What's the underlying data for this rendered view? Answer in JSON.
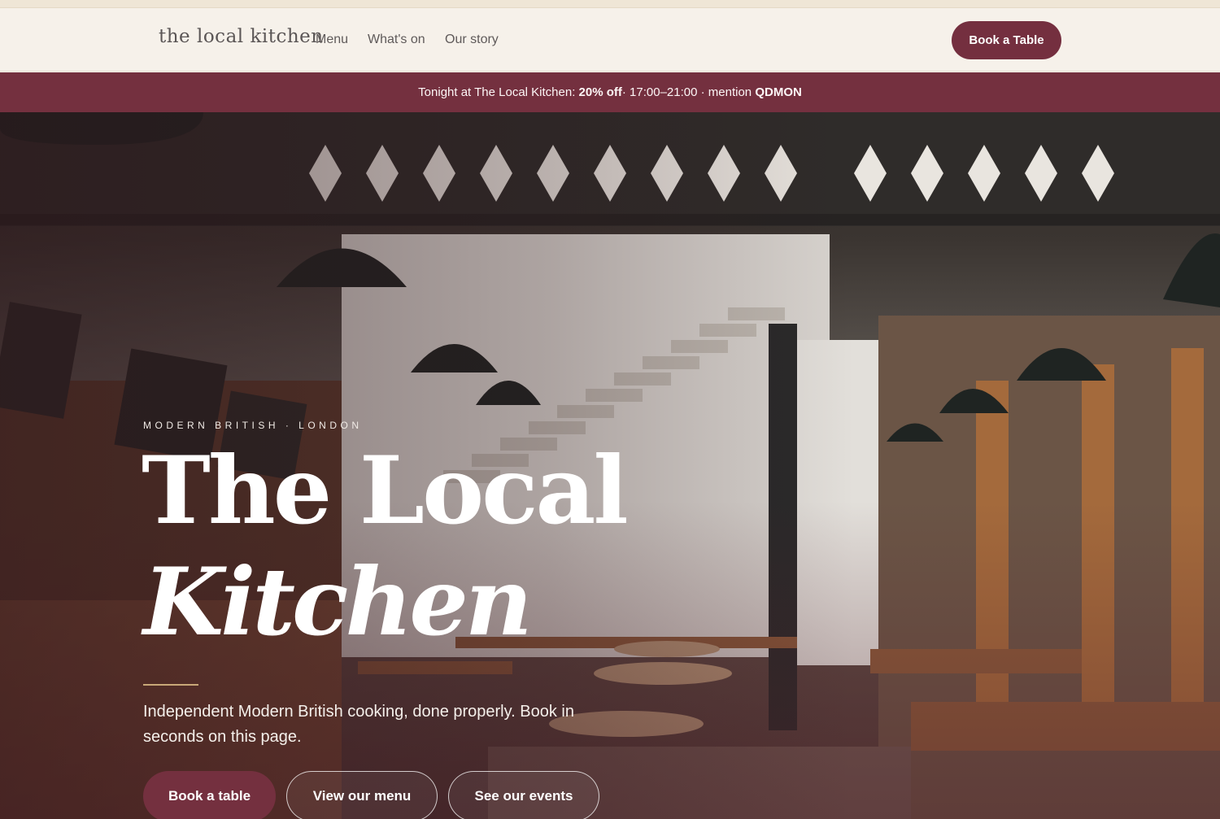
{
  "nav": {
    "brand": "the local kitchen",
    "links": [
      "Menu",
      "What's on",
      "Our story"
    ],
    "cta": "Book a Table"
  },
  "promo": {
    "prefix": "Tonight at The Local Kitchen: ",
    "discount": "20% off",
    "middle": " · 17:00–21:00 · mention ",
    "code": "QDMON"
  },
  "hero": {
    "eyebrow": "MODERN BRITISH · LONDON",
    "title_line1": "The Local",
    "title_line2": "Kitchen",
    "tagline": "Independent Modern British cooking, done properly. Book in seconds on this page.",
    "buttons": {
      "book": "Book a table",
      "menu": "View our menu",
      "events": "See our events"
    }
  },
  "colors": {
    "accent": "#74303f",
    "background": "#f6f1ea",
    "rule": "#c9a878"
  }
}
